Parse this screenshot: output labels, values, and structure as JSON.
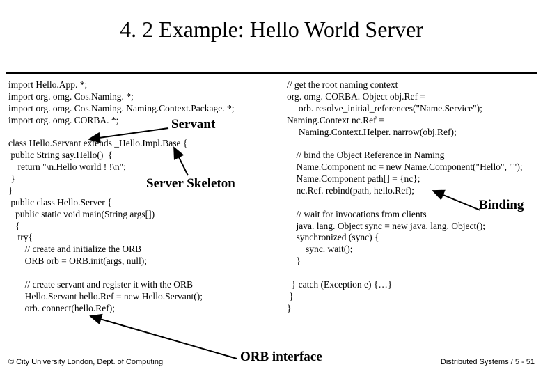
{
  "title": "4. 2 Example: Hello World Server",
  "labels": {
    "servant": "Servant",
    "server_skeleton": "Server Skeleton",
    "binding": "Binding",
    "orb_interface": "ORB interface"
  },
  "footer": {
    "left": "© City University London, Dept. of Computing",
    "right": "Distributed Systems / 5 - 51"
  },
  "code_left": "import Hello.App. *;\nimport org. omg. Cos.Naming. *;\nimport org. omg. Cos.Naming. Naming.Context.Package. *;\nimport org. omg. CORBA. *;\n\nclass Hello.Servant extends _Hello.Impl.Base {\n public String say.Hello()  {\n    return \"\\n.Hello world ! !\\n\";\n }\n}\n public class Hello.Server {\n   public static void main(String args[])\n   {\n    try{\n       // create and initialize the ORB\n       ORB orb = ORB.init(args, null);\n\n       // create servant and register it with the ORB\n       Hello.Servant hello.Ref = new Hello.Servant();\n       orb. connect(hello.Ref);",
  "code_right": "// get the root naming context\norg. omg. CORBA. Object obj.Ref =\n     orb. resolve_initial_references(\"Name.Service\");\nNaming.Context nc.Ref =\n     Naming.Context.Helper. narrow(obj.Ref);\n\n    // bind the Object Reference in Naming\n    Name.Component nc = new Name.Component(\"Hello\", \"\");\n    Name.Component path[] = {nc};\n    nc.Ref. rebind(path, hello.Ref);\n\n    // wait for invocations from clients\n    java. lang. Object sync = new java. lang. Object();\n    synchronized (sync) {\n        sync. wait();\n    }\n\n  } catch (Exception e) {…}\n }\n}"
}
